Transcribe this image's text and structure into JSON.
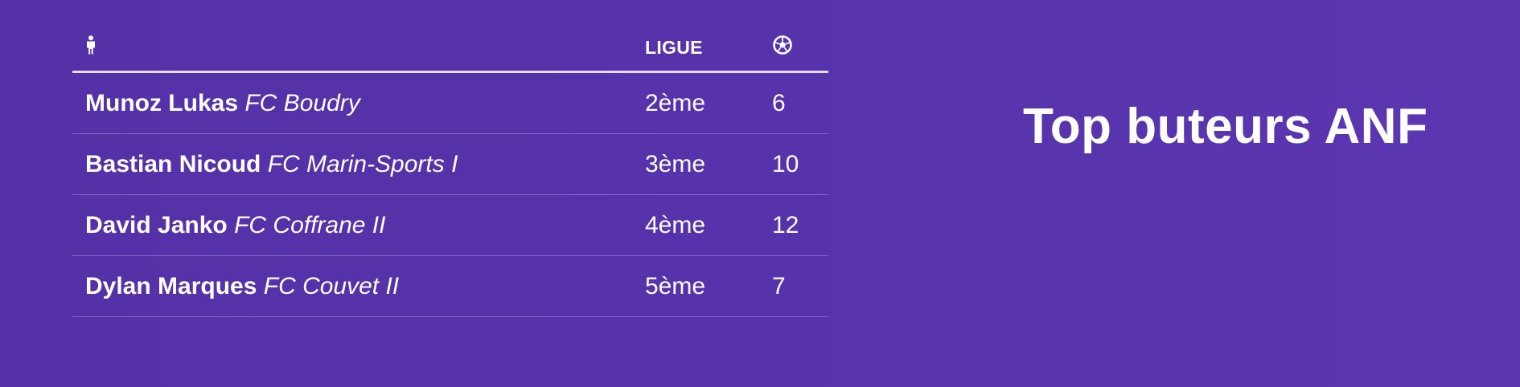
{
  "title": "Top buteurs ANF",
  "table": {
    "headers": {
      "player_icon": "person-icon",
      "league": "LIGUE",
      "goals_icon": "soccer-ball-icon"
    },
    "rows": [
      {
        "player": "Munoz Lukas",
        "team": "FC Boudry",
        "league": "2ème",
        "goals": "6"
      },
      {
        "player": "Bastian Nicoud",
        "team": "FC Marin-Sports I",
        "league": "3ème",
        "goals": "10"
      },
      {
        "player": "David Janko",
        "team": "FC Coffrane II",
        "league": "4ème",
        "goals": "12"
      },
      {
        "player": "Dylan Marques",
        "team": "FC Couvet II",
        "league": "5ème",
        "goals": "7"
      }
    ]
  }
}
